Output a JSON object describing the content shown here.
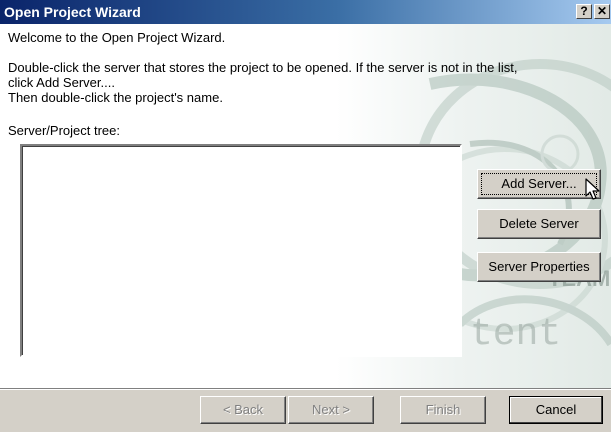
{
  "window": {
    "title": "Open Project Wizard",
    "help_label": "?",
    "close_label": "✕"
  },
  "main": {
    "welcome": "Welcome to the Open Project Wizard.",
    "instruction_line1": "Double-click the server that stores the project to be opened. If the server is not in the list,",
    "instruction_line2": "click Add Server....",
    "instruction_line3": "Then double-click the project's name.",
    "tree_label": "Server/Project tree:",
    "tree_items": []
  },
  "side_buttons": {
    "add_server": "Add Server...",
    "delete_server": "Delete Server",
    "server_properties": "Server Properties"
  },
  "footer": {
    "back": "< Back",
    "next": "Next >",
    "finish": "Finish",
    "cancel": "Cancel"
  },
  "background_art": {
    "word_team": "TEAM",
    "word_content": "tent"
  },
  "colors": {
    "title_bar_start": "#0a246a",
    "title_bar_end": "#a6caf0",
    "dialog_face": "#d4d0c8"
  }
}
